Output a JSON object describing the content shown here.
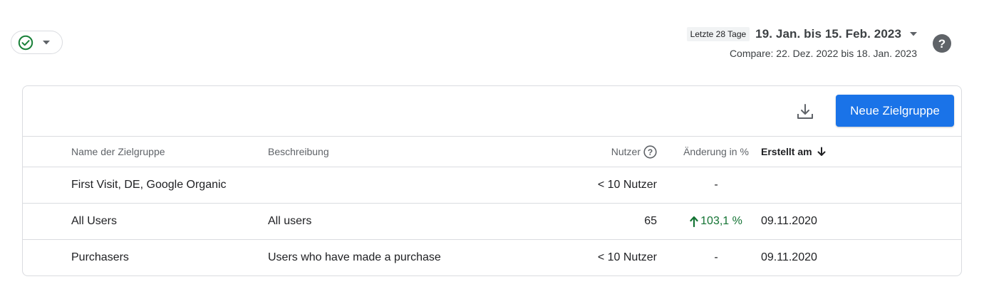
{
  "filter": {
    "status_icon": "check-circle-icon",
    "accent": "#188038"
  },
  "date": {
    "period_badge": "Letzte 28 Tage",
    "range": "19. Jan. bis 15. Feb. 2023",
    "compare": "Compare: 22. Dez. 2022 bis 18. Jan. 2023"
  },
  "toolbar": {
    "new_audience_label": "Neue Zielgruppe",
    "primary_color": "#1a73e8"
  },
  "table": {
    "columns": {
      "name": "Name der Zielgruppe",
      "description": "Beschreibung",
      "users": "Nutzer",
      "change": "Änderung in %",
      "created": "Erstellt am"
    },
    "rows": [
      {
        "name": "First Visit, DE, Google Organic",
        "description": "",
        "users": "< 10 Nutzer",
        "change": "-",
        "created": ""
      },
      {
        "name": "All Users",
        "description": "All users",
        "users": "65",
        "change": "103,1 %",
        "change_direction": "up",
        "created": "09.11.2020"
      },
      {
        "name": "Purchasers",
        "description": "Users who have made a purchase",
        "users": "< 10 Nutzer",
        "change": "-",
        "created": "09.11.2020"
      }
    ]
  }
}
